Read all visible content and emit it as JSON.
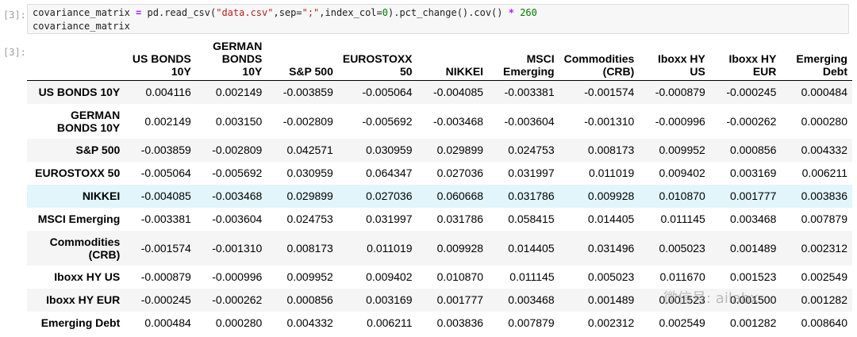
{
  "cell": {
    "in_prompt": "[3]:",
    "out_prompt": "[3]:",
    "code_lines": {
      "line1": {
        "var": "covariance_matrix",
        "op_assign": " = ",
        "p1": "pd.read_csv(",
        "s1": "\"data.csv\"",
        "p2": ",sep=",
        "s2": "\";\"",
        "p3": ",index_col=",
        "n1": "0",
        "p4": ").pct_change().cov() ",
        "op_mul": "*",
        "sp": " ",
        "n2": "260"
      },
      "line2": "covariance_matrix"
    }
  },
  "table": {
    "columns": [
      "US BONDS 10Y",
      "GERMAN BONDS 10Y",
      "S&P 500",
      "EUROSTOXX 50",
      "NIKKEI",
      "MSCI Emerging",
      "Commodities (CRB)",
      "Iboxx HY US",
      "Iboxx HY EUR",
      "Emerging Debt"
    ],
    "rows": [
      {
        "label": "US BONDS 10Y",
        "values": [
          "0.004116",
          "0.002149",
          "-0.003859",
          "-0.005064",
          "-0.004085",
          "-0.003381",
          "-0.001574",
          "-0.000879",
          "-0.000245",
          "0.000484"
        ]
      },
      {
        "label": "GERMAN BONDS 10Y",
        "values": [
          "0.002149",
          "0.003150",
          "-0.002809",
          "-0.005692",
          "-0.003468",
          "-0.003604",
          "-0.001310",
          "-0.000996",
          "-0.000262",
          "0.000280"
        ]
      },
      {
        "label": "S&P 500",
        "values": [
          "-0.003859",
          "-0.002809",
          "0.042571",
          "0.030959",
          "0.029899",
          "0.024753",
          "0.008173",
          "0.009952",
          "0.000856",
          "0.004332"
        ]
      },
      {
        "label": "EUROSTOXX 50",
        "values": [
          "-0.005064",
          "-0.005692",
          "0.030959",
          "0.064347",
          "0.027036",
          "0.031997",
          "0.011019",
          "0.009402",
          "0.003169",
          "0.006211"
        ]
      },
      {
        "label": "NIKKEI",
        "values": [
          "-0.004085",
          "-0.003468",
          "0.029899",
          "0.027036",
          "0.060668",
          "0.031786",
          "0.009928",
          "0.010870",
          "0.001777",
          "0.003836"
        ]
      },
      {
        "label": "MSCI Emerging",
        "values": [
          "-0.003381",
          "-0.003604",
          "0.024753",
          "0.031997",
          "0.031786",
          "0.058415",
          "0.014405",
          "0.011145",
          "0.003468",
          "0.007879"
        ]
      },
      {
        "label": "Commodities (CRB)",
        "values": [
          "-0.001574",
          "-0.001310",
          "0.008173",
          "0.011019",
          "0.009928",
          "0.014405",
          "0.031496",
          "0.005023",
          "0.001489",
          "0.002312"
        ]
      },
      {
        "label": "Iboxx HY US",
        "values": [
          "-0.000879",
          "-0.000996",
          "0.009952",
          "0.009402",
          "0.010870",
          "0.011145",
          "0.005023",
          "0.011670",
          "0.001523",
          "0.002549"
        ]
      },
      {
        "label": "Iboxx HY EUR",
        "values": [
          "-0.000245",
          "-0.000262",
          "0.000856",
          "0.003169",
          "0.001777",
          "0.003468",
          "0.001489",
          "0.001523",
          "0.001500",
          "0.001282"
        ]
      },
      {
        "label": "Emerging Debt",
        "values": [
          "0.000484",
          "0.000280",
          "0.004332",
          "0.006211",
          "0.003836",
          "0.007879",
          "0.002312",
          "0.002549",
          "0.001282",
          "0.008640"
        ]
      }
    ],
    "highlighted_row_index": 4,
    "highlight_color": "#e1f5fb"
  },
  "watermark": "微信号: ailabx"
}
